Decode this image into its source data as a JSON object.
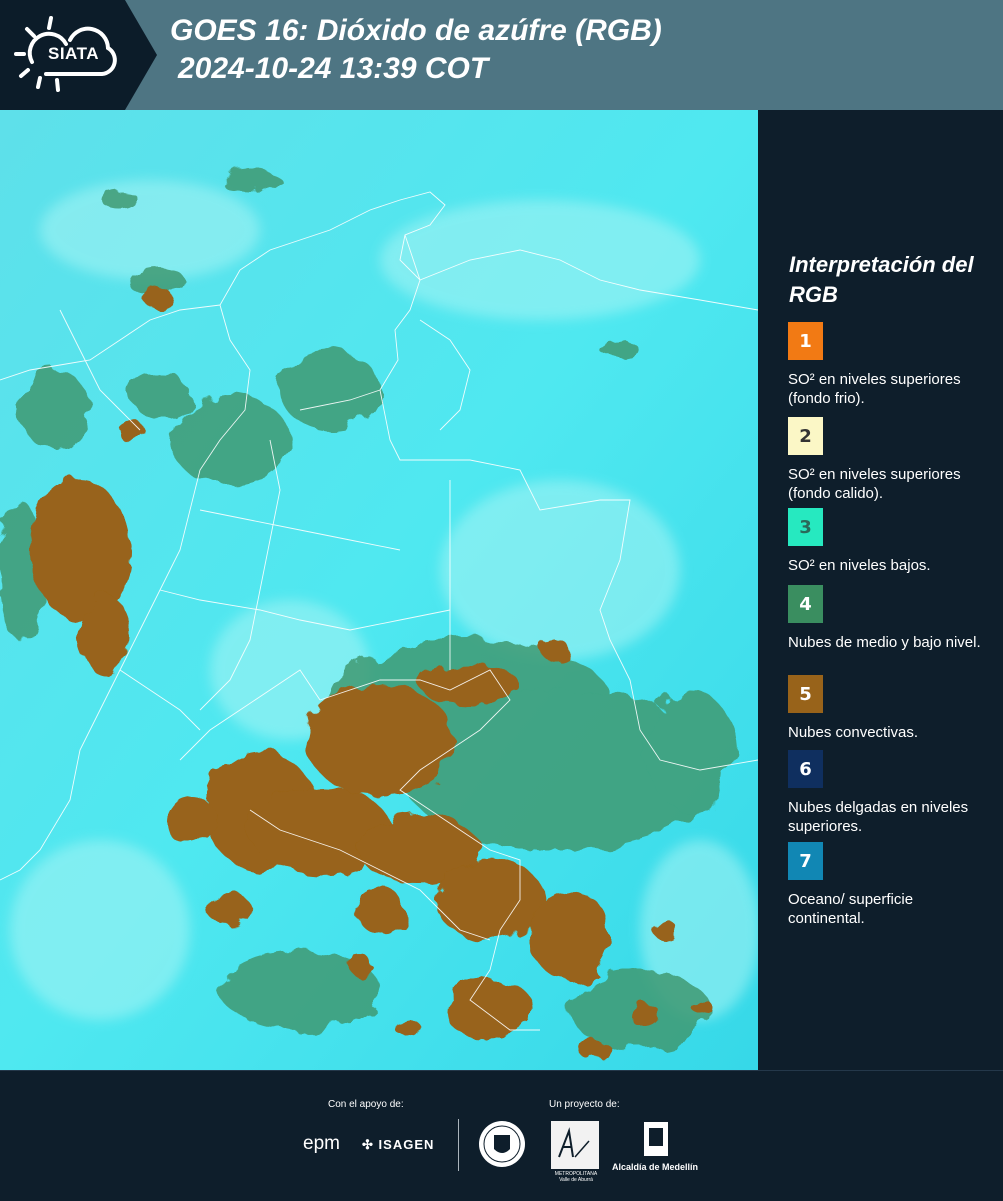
{
  "header": {
    "logo_text": "SIATA",
    "title_line1": "GOES 16: Dióxido de azúfre (RGB)",
    "title_line2": "2024-10-24 13:39 COT"
  },
  "legend": {
    "title": "Interpretación del RGB",
    "items": [
      {
        "number": "1",
        "color": "#f27a14",
        "text_color": "#ffffff",
        "label": "SO² en niveles superiores (fondo frio)."
      },
      {
        "number": "2",
        "color": "#fbf7c6",
        "text_color": "#333333",
        "label": "SO² en niveles superiores (fondo calido)."
      },
      {
        "number": "3",
        "color": "#26e9c0",
        "text_color": "#2a6a5a",
        "label": "SO² en niveles bajos."
      },
      {
        "number": "4",
        "color": "#3a8e60",
        "text_color": "#ffffff",
        "label": "Nubes de medio y bajo nivel."
      },
      {
        "number": "5",
        "color": "#98631a",
        "text_color": "#ffffff",
        "label": "Nubes convectivas."
      },
      {
        "number": "6",
        "color": "#0f2f5f",
        "text_color": "#ffffff",
        "label": "Nubes delgadas en niveles superiores."
      },
      {
        "number": "7",
        "color": "#1187b4",
        "text_color": "#ffffff",
        "label": "Oceano/ superficie continental."
      }
    ]
  },
  "footer": {
    "support_label": "Con el apoyo de:",
    "project_label": "Un proyecto de:",
    "epm": "epm",
    "isagen": "ISAGEN",
    "alcaldia": "Alcaldía de Medellín",
    "area_text": "METROPOLITANA Valle de Aburrá"
  }
}
